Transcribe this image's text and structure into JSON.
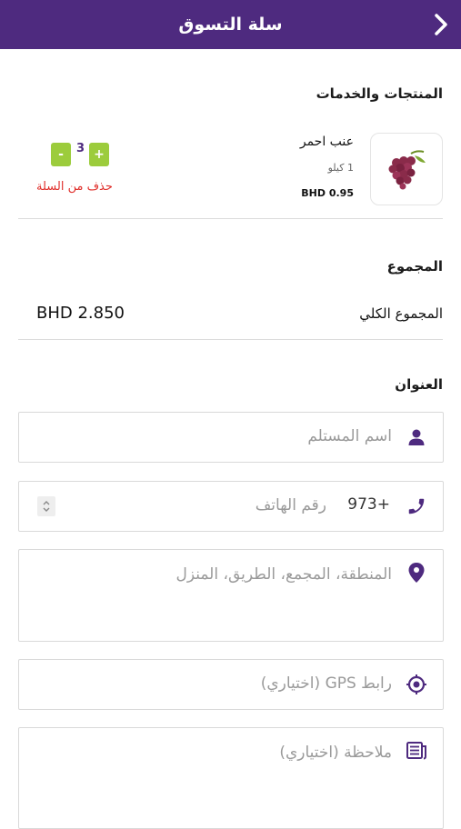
{
  "header": {
    "title": "سلة التسوق",
    "back_icon": "chevron-right-icon"
  },
  "sections": {
    "products_title": "المنتجات والخدمات",
    "total_title": "المجموع",
    "address_title": "العنوان"
  },
  "product": {
    "name": "عنب احمر",
    "unit": "1 كيلو",
    "price": "BHD 0.95",
    "quantity": "3",
    "plus_label": "+",
    "minus_label": "-",
    "remove_label": "حذف من السلة",
    "image_icon": "grapes-icon"
  },
  "total": {
    "label": "المجموع الكلي",
    "value": "BHD 2.850"
  },
  "form": {
    "name_placeholder": "اسم المستلم",
    "phone_code": "973+",
    "phone_placeholder": "رقم الهاتف",
    "address_placeholder": "المنطقة، المجمع، الطريق، المنزل",
    "gps_placeholder": "رابط GPS (اختياري)",
    "note_placeholder": "ملاحظة (اختياري)"
  },
  "colors": {
    "brand": "#4e2a7f",
    "accent_green": "#9ccc3c",
    "danger": "#e0302c"
  }
}
